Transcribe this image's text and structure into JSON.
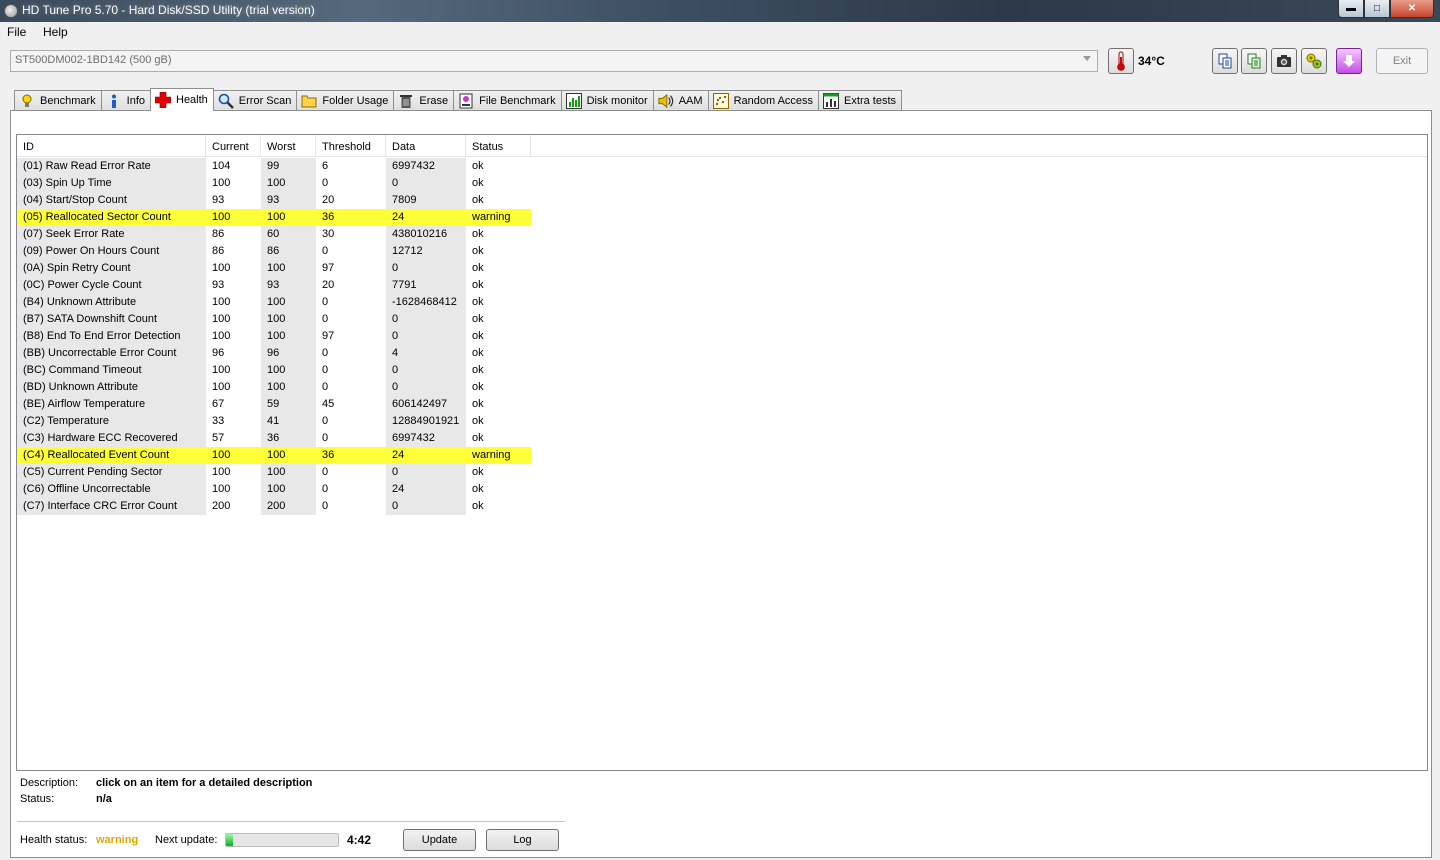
{
  "window": {
    "title": "HD Tune Pro 5.70 - Hard Disk/SSD Utility (trial version)"
  },
  "menu": {
    "file": "File",
    "help": "Help"
  },
  "drive": {
    "selected": "ST500DM002-1BD142 (500 gB)"
  },
  "temperature": "34°C",
  "exit_label": "Exit",
  "tabs": [
    {
      "label": "Benchmark"
    },
    {
      "label": "Info"
    },
    {
      "label": "Health"
    },
    {
      "label": "Error Scan"
    },
    {
      "label": "Folder Usage"
    },
    {
      "label": "Erase"
    },
    {
      "label": "File Benchmark"
    },
    {
      "label": "Disk monitor"
    },
    {
      "label": "AAM"
    },
    {
      "label": "Random Access"
    },
    {
      "label": "Extra tests"
    }
  ],
  "table": {
    "headers": [
      "ID",
      "Current",
      "Worst",
      "Threshold",
      "Data",
      "Status"
    ],
    "rows": [
      [
        "(01) Raw Read Error Rate",
        "104",
        "99",
        "6",
        "6997432",
        "ok"
      ],
      [
        "(03) Spin Up Time",
        "100",
        "100",
        "0",
        "0",
        "ok"
      ],
      [
        "(04) Start/Stop Count",
        "93",
        "93",
        "20",
        "7809",
        "ok"
      ],
      [
        "(05) Reallocated Sector Count",
        "100",
        "100",
        "36",
        "24",
        "warning"
      ],
      [
        "(07) Seek Error Rate",
        "86",
        "60",
        "30",
        "438010216",
        "ok"
      ],
      [
        "(09) Power On Hours Count",
        "86",
        "86",
        "0",
        "12712",
        "ok"
      ],
      [
        "(0A) Spin Retry Count",
        "100",
        "100",
        "97",
        "0",
        "ok"
      ],
      [
        "(0C) Power Cycle Count",
        "93",
        "93",
        "20",
        "7791",
        "ok"
      ],
      [
        "(B4) Unknown Attribute",
        "100",
        "100",
        "0",
        "-1628468412",
        "ok"
      ],
      [
        "(B7) SATA Downshift Count",
        "100",
        "100",
        "0",
        "0",
        "ok"
      ],
      [
        "(B8) End To End Error Detection",
        "100",
        "100",
        "97",
        "0",
        "ok"
      ],
      [
        "(BB) Uncorrectable Error Count",
        "96",
        "96",
        "0",
        "4",
        "ok"
      ],
      [
        "(BC) Command Timeout",
        "100",
        "100",
        "0",
        "0",
        "ok"
      ],
      [
        "(BD) Unknown Attribute",
        "100",
        "100",
        "0",
        "0",
        "ok"
      ],
      [
        "(BE) Airflow Temperature",
        "67",
        "59",
        "45",
        "606142497",
        "ok"
      ],
      [
        "(C2) Temperature",
        "33",
        "41",
        "0",
        "12884901921",
        "ok"
      ],
      [
        "(C3) Hardware ECC Recovered",
        "57",
        "36",
        "0",
        "6997432",
        "ok"
      ],
      [
        "(C4) Reallocated Event Count",
        "100",
        "100",
        "36",
        "24",
        "warning"
      ],
      [
        "(C5) Current Pending Sector",
        "100",
        "100",
        "0",
        "0",
        "ok"
      ],
      [
        "(C6) Offline Uncorrectable",
        "100",
        "100",
        "0",
        "24",
        "ok"
      ],
      [
        "(C7) Interface CRC Error Count",
        "200",
        "200",
        "0",
        "0",
        "ok"
      ]
    ]
  },
  "details": {
    "description_label": "Description:",
    "description_value": "click on an item for a detailed description",
    "status_label": "Status:",
    "status_value": "n/a"
  },
  "footer": {
    "health_label": "Health status:",
    "health_value": "warning",
    "next_update_label": "Next update:",
    "next_update_time": "4:42",
    "progress_fraction": 0.06,
    "update_label": "Update",
    "log_label": "Log"
  },
  "colors": {
    "warning_highlight": "#ffff37",
    "health_warning_text": "#e0a800",
    "progress_fill": "#06b025"
  },
  "icons": [
    "thermometer-icon",
    "copy-icon",
    "copy-all-icon",
    "camera-icon",
    "options-icon",
    "save-icon"
  ]
}
